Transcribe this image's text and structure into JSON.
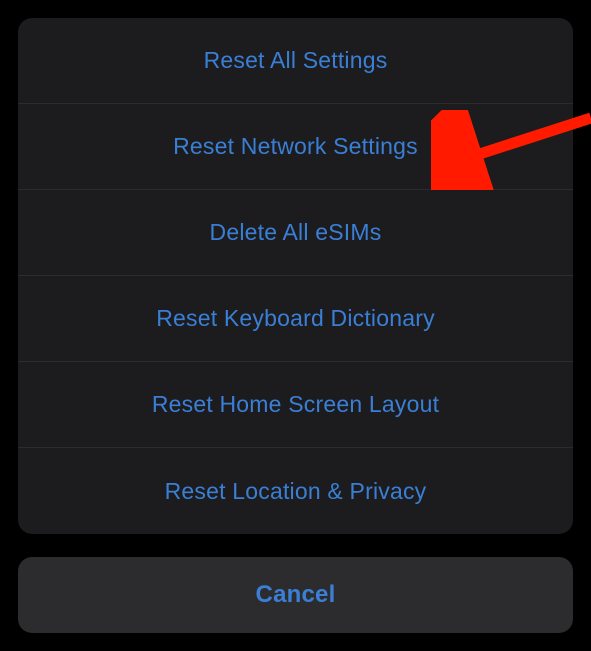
{
  "sheet": {
    "options": [
      {
        "label": "Reset All Settings",
        "name": "reset-all-settings"
      },
      {
        "label": "Reset Network Settings",
        "name": "reset-network-settings"
      },
      {
        "label": "Delete All eSIMs",
        "name": "delete-all-esims"
      },
      {
        "label": "Reset Keyboard Dictionary",
        "name": "reset-keyboard-dictionary"
      },
      {
        "label": "Reset Home Screen Layout",
        "name": "reset-home-screen-layout"
      },
      {
        "label": "Reset Location & Privacy",
        "name": "reset-location-privacy"
      }
    ],
    "cancel_label": "Cancel"
  },
  "annotation": {
    "arrow_target": "reset-network-settings"
  }
}
